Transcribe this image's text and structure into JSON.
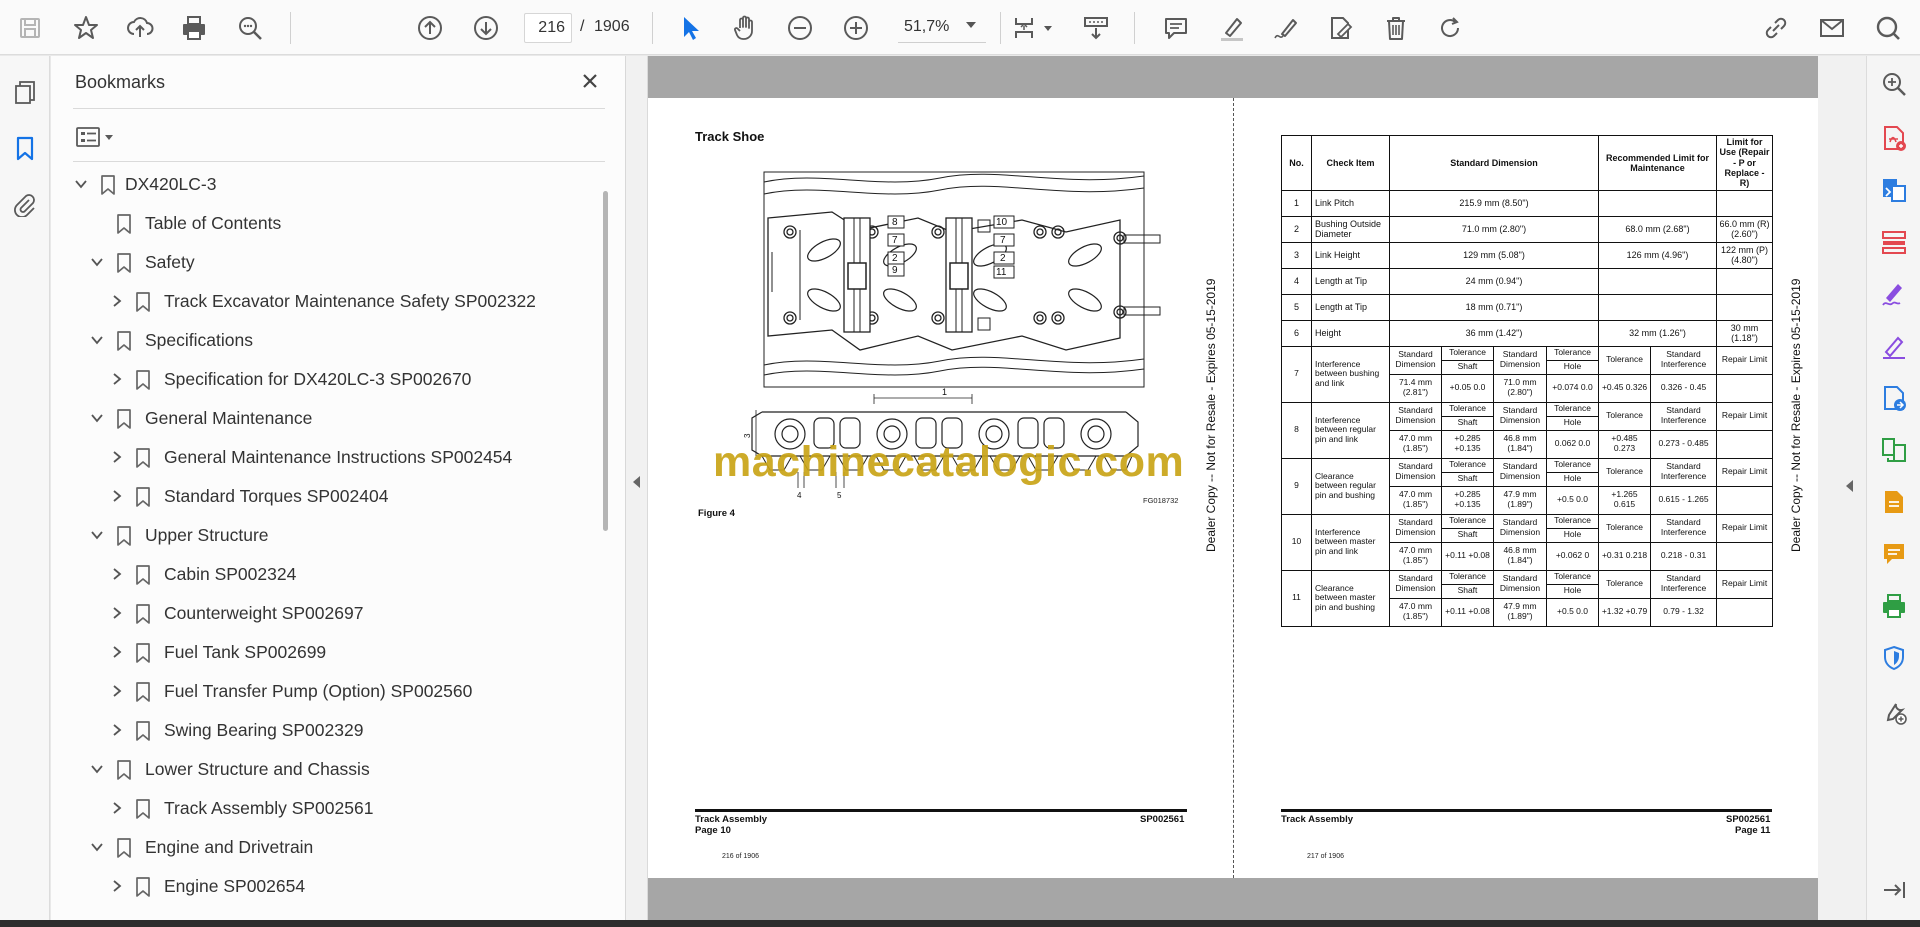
{
  "toolbar": {
    "current_page": "216",
    "page_separator": "/",
    "total_pages": "1906",
    "zoom": "51,7%"
  },
  "bookmarks": {
    "title": "Bookmarks",
    "items": [
      {
        "label": "DX420LC-3",
        "level": 0,
        "expander": "open"
      },
      {
        "label": "Table of Contents",
        "level": 1,
        "expander": "none"
      },
      {
        "label": "Safety",
        "level": 1,
        "expander": "open"
      },
      {
        "label": "Track Excavator Maintenance Safety SP002322",
        "level": 2,
        "expander": "closed"
      },
      {
        "label": "Specifications",
        "level": 1,
        "expander": "open"
      },
      {
        "label": "Specification for DX420LC-3 SP002670",
        "level": 2,
        "expander": "closed"
      },
      {
        "label": "General Maintenance",
        "level": 1,
        "expander": "open"
      },
      {
        "label": "General Maintenance Instructions SP002454",
        "level": 2,
        "expander": "closed"
      },
      {
        "label": "Standard Torques SP002404",
        "level": 2,
        "expander": "closed"
      },
      {
        "label": "Upper Structure",
        "level": 1,
        "expander": "open"
      },
      {
        "label": "Cabin SP002324",
        "level": 2,
        "expander": "closed"
      },
      {
        "label": "Counterweight SP002697",
        "level": 2,
        "expander": "closed"
      },
      {
        "label": "Fuel Tank SP002699",
        "level": 2,
        "expander": "closed"
      },
      {
        "label": "Fuel Transfer Pump (Option) SP002560",
        "level": 2,
        "expander": "closed"
      },
      {
        "label": "Swing Bearing SP002329",
        "level": 2,
        "expander": "closed"
      },
      {
        "label": "Lower Structure and Chassis",
        "level": 1,
        "expander": "open"
      },
      {
        "label": "Track Assembly SP002561",
        "level": 2,
        "expander": "closed"
      },
      {
        "label": "Engine and Drivetrain",
        "level": 1,
        "expander": "open"
      },
      {
        "label": "Engine SP002654",
        "level": 2,
        "expander": "closed"
      }
    ]
  },
  "left_page": {
    "title": "Track Shoe",
    "figure_label": "Figure 4",
    "figure_code": "FG018732",
    "callouts": [
      "8",
      "7",
      "2",
      "9",
      "10",
      "7",
      "2",
      "11",
      "1",
      "3",
      "4",
      "5"
    ],
    "side_text": "Dealer Copy -- Not for Resale - Expires 05-15-2019",
    "footer_left_1": "Track Assembly",
    "footer_left_2": "Page 10",
    "footer_right": "SP002561",
    "page_count": "216 of 1906"
  },
  "watermark": "machinecatalogic.com",
  "right_page": {
    "side_text": "Dealer Copy -- Not for Resale - Expires 05-15-2019",
    "footer_left": "Track Assembly",
    "footer_right_1": "SP002561",
    "footer_right_2": "Page 11",
    "page_count": "217 of 1906",
    "table": {
      "headers": [
        "No.",
        "Check Item",
        "Standard Dimension",
        "Recommended Limit for Maintenance",
        "Limit for Use (Repair - P or Replace - R)"
      ],
      "simple_rows": [
        {
          "no": "1",
          "item": "Link Pitch",
          "std": "215.9 mm (8.50\")",
          "rec": "",
          "lim": ""
        },
        {
          "no": "2",
          "item": "Bushing Outside Diameter",
          "std": "71.0 mm (2.80\")",
          "rec": "68.0 mm (2.68\")",
          "lim": "66.0 mm (R) (2.60\")"
        },
        {
          "no": "3",
          "item": "Link Height",
          "std": "129 mm (5.08\")",
          "rec": "126 mm (4.96\")",
          "lim": "122 mm (P) (4.80\")"
        },
        {
          "no": "4",
          "item": "Length at Tip",
          "std": "24 mm (0.94\")",
          "rec": "",
          "lim": ""
        },
        {
          "no": "5",
          "item": "Length at Tip",
          "std": "18 mm (0.71\")",
          "rec": "",
          "lim": ""
        },
        {
          "no": "6",
          "item": "Height",
          "std": "36 mm (1.42\")",
          "rec": "32 mm (1.26\")",
          "lim": "30 mm (1.18\")"
        }
      ],
      "sub_labels": {
        "std_dim": "Standard Dimension",
        "tolerance": "Tolerance",
        "shaft": "Shaft",
        "hole": "Hole",
        "std_int": "Standard Interference",
        "repair": "Repair Limit"
      },
      "complex_rows": [
        {
          "no": "7",
          "item": "Interference between bushing and link",
          "d1": "71.4 mm (2.81\")",
          "shaft": "+0.05 0.0",
          "d2": "71.0 mm (2.80\")",
          "hole": "+0.074 0.0",
          "tol": "+0.45 0.326",
          "si": "0.326 - 0.45",
          "rl": ""
        },
        {
          "no": "8",
          "item": "Interference between regular pin and link",
          "d1": "47.0 mm (1.85\")",
          "shaft": "+0.285 +0.135",
          "d2": "46.8 mm (1.84\")",
          "hole": "0.062 0.0",
          "tol": "+0.485 0.273",
          "si": "0.273 - 0.485",
          "rl": ""
        },
        {
          "no": "9",
          "item": "Clearance between regular pin and bushing",
          "d1": "47.0 mm (1.85\")",
          "shaft": "+0.285 +0.135",
          "d2": "47.9 mm (1.89\")",
          "hole": "+0.5 0.0",
          "tol": "+1.265 0.615",
          "si": "0.615 - 1.265",
          "rl": ""
        },
        {
          "no": "10",
          "item": "Interference between master pin and link",
          "d1": "47.0 mm (1.85\")",
          "shaft": "+0.11 +0.08",
          "d2": "46.8 mm (1.84\")",
          "hole": "+0.062 0",
          "tol": "+0.31 0.218",
          "si": "0.218 - 0.31",
          "rl": ""
        },
        {
          "no": "11",
          "item": "Clearance between master pin and bushing",
          "d1": "47.0 mm (1.85\")",
          "shaft": "+0.11 +0.08",
          "d2": "47.9 mm (1.89\")",
          "hole": "+0.5 0.0",
          "tol": "+1.32 +0.79",
          "si": "0.79 - 1.32",
          "rl": ""
        }
      ]
    }
  },
  "colors": {
    "accent_blue": "#1473e6",
    "icon_gray": "#5a5a5a",
    "rail_red": "#e34850",
    "rail_blue": "#2d7de0",
    "rail_purple": "#8a4de0",
    "rail_orange": "#e79a14",
    "rail_green": "#2f9e44",
    "watermark": "#c9a417"
  },
  "icons": {
    "toolbar": [
      "save-icon",
      "star-icon",
      "upload-icon",
      "print-icon",
      "find-icon",
      "prev-page-icon",
      "next-page-icon",
      "select-arrow-icon",
      "hand-icon",
      "zoom-out-icon",
      "zoom-in-icon",
      "page-fit-icon",
      "scroll-mode-icon",
      "comment-icon",
      "highlight-icon",
      "sign-icon",
      "fill-sign-icon",
      "delete-icon",
      "rotate-icon",
      "share-link-icon",
      "mail-icon",
      "account-icon"
    ],
    "right_rail": [
      "zoom-search-icon",
      "export-pdf-icon",
      "create-pdf-icon",
      "organize-pages-icon",
      "fill-sign-icon",
      "edit-pdf-icon",
      "export-icon",
      "compare-icon",
      "comment-icon",
      "stamp-icon",
      "print-production-icon",
      "protect-icon",
      "more-tools-icon",
      "expand-icon"
    ]
  }
}
